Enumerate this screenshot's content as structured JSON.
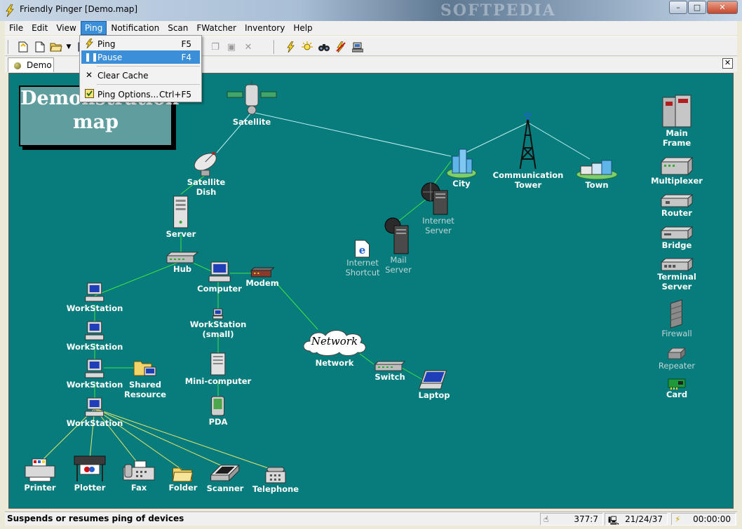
{
  "window": {
    "title": "Friendly Pinger [Demo.map]",
    "watermark": "SOFTPEDIA",
    "buttons": {
      "minimize": "–",
      "maximize": "□",
      "close": "✕"
    }
  },
  "menu": [
    "File",
    "Edit",
    "View",
    "Ping",
    "Notification",
    "Scan",
    "FWatcher",
    "Inventory",
    "Help"
  ],
  "active_menu": "Ping",
  "ping_menu": [
    {
      "label": "Ping",
      "shortcut": "F5",
      "icon": "lightning-icon"
    },
    {
      "label": "Pause",
      "shortcut": "F4",
      "icon": "pause-icon",
      "highlighted": true
    },
    {
      "label": "Clear Cache",
      "shortcut": "",
      "icon": "cross-icon"
    },
    {
      "label": "Ping Options...",
      "shortcut": "Ctrl+F5",
      "icon": "checkbox-icon"
    }
  ],
  "tabs": [
    {
      "label": "Demo"
    }
  ],
  "map": {
    "title_line1": "Demonstration",
    "title_line2": "map",
    "background": "#087c7d",
    "link_color_active": "#3fe43f",
    "link_color_sky": "#bfeff0",
    "link_color_yellow": "#e5e86a",
    "cloud_text": "Network",
    "nodes": {
      "satellite": "Satellite",
      "dish_1": "Satellite",
      "dish_2": "Dish",
      "server": "Server",
      "hub": "Hub",
      "computer": "Computer",
      "modem": "Modem",
      "ws_small_1": "WorkStation",
      "ws_small_2": "(small)",
      "minicomputer": "Mini-computer",
      "pda": "PDA",
      "network": "Network",
      "switch": "Switch",
      "laptop": "Laptop",
      "workstation": "WorkStation",
      "shared_1": "Shared",
      "shared_2": "Resource",
      "printer": "Printer",
      "plotter": "Plotter",
      "fax": "Fax",
      "folder": "Folder",
      "scanner": "Scanner",
      "telephone": "Telephone",
      "city": "City",
      "tower_1": "Communication",
      "tower_2": "Tower",
      "town": "Town",
      "inet_server_1": "Internet",
      "inet_server_2": "Server",
      "inet_shortcut_1": "Internet",
      "inet_shortcut_2": "Shortcut",
      "mail_server_1": "Mail",
      "mail_server_2": "Server",
      "mainframe_1": "Main",
      "mainframe_2": "Frame",
      "multiplexer": "Multiplexer",
      "router": "Router",
      "bridge": "Bridge",
      "terminal_1": "Terminal",
      "terminal_2": "Server",
      "firewall": "Firewall",
      "repeater": "Repeater",
      "card": "Card"
    }
  },
  "status": {
    "message": "Suspends or resumes ping of devices",
    "coords": "377:7",
    "counts": "21/24/37",
    "timer": "00:00:00"
  }
}
